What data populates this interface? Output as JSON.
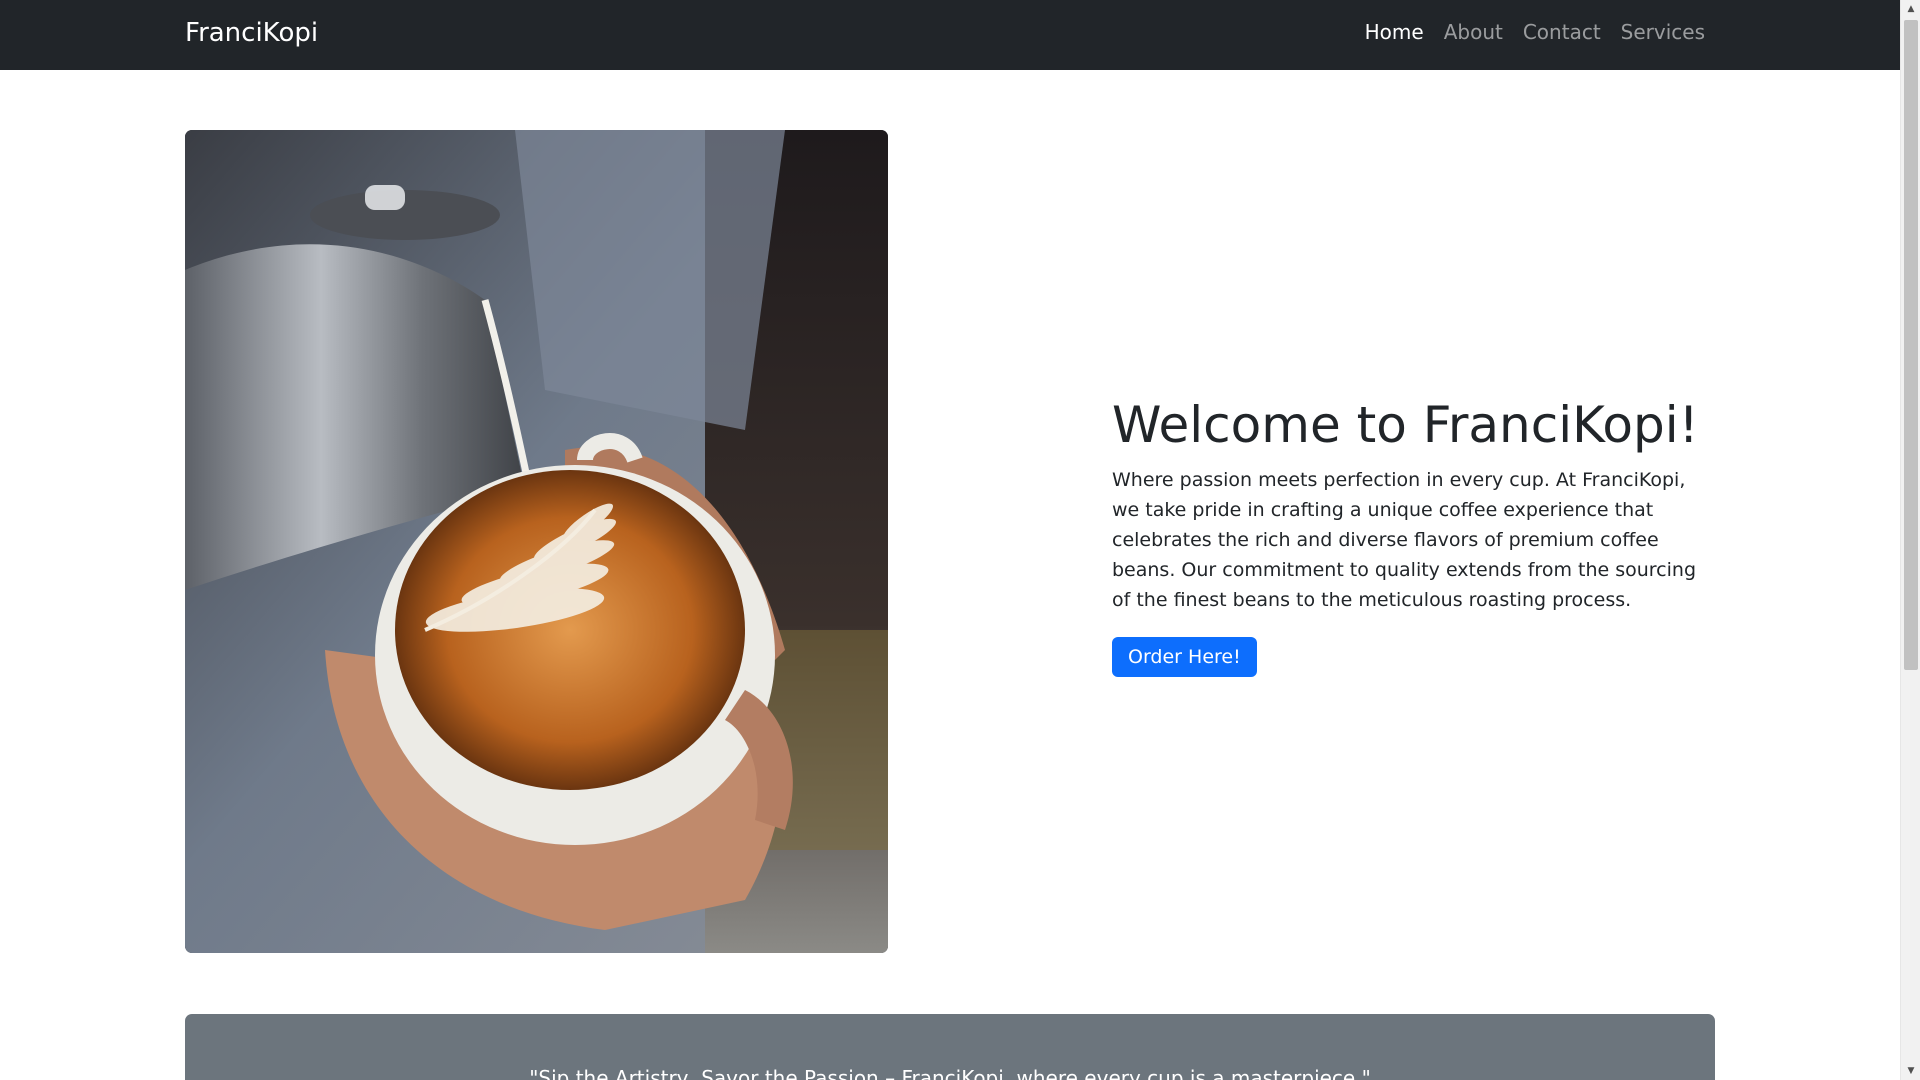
{
  "navbar": {
    "brand": "FranciKopi",
    "links": [
      {
        "label": "Home",
        "active": true
      },
      {
        "label": "About",
        "active": false
      },
      {
        "label": "Contact",
        "active": false
      },
      {
        "label": "Services",
        "active": false
      }
    ]
  },
  "hero": {
    "title": "Welcome to FranciKopi!",
    "description": "Where passion meets perfection in every cup. At FranciKopi, we take pride in crafting a unique coffee experience that celebrates the rich and diverse flavors of premium coffee beans. Our commitment to quality extends from the sourcing of the finest beans to the meticulous roasting process.",
    "button_label": "Order Here!",
    "image_icon": "latte-art-photo"
  },
  "quote": {
    "text": "\"Sip the Artistry, Savor the Passion – FranciKopi, where every cup is a masterpiece.\""
  },
  "colors": {
    "navbar_bg": "#212529",
    "primary": "#0d6efd",
    "quote_bg": "#6c757d",
    "text": "#212529"
  }
}
